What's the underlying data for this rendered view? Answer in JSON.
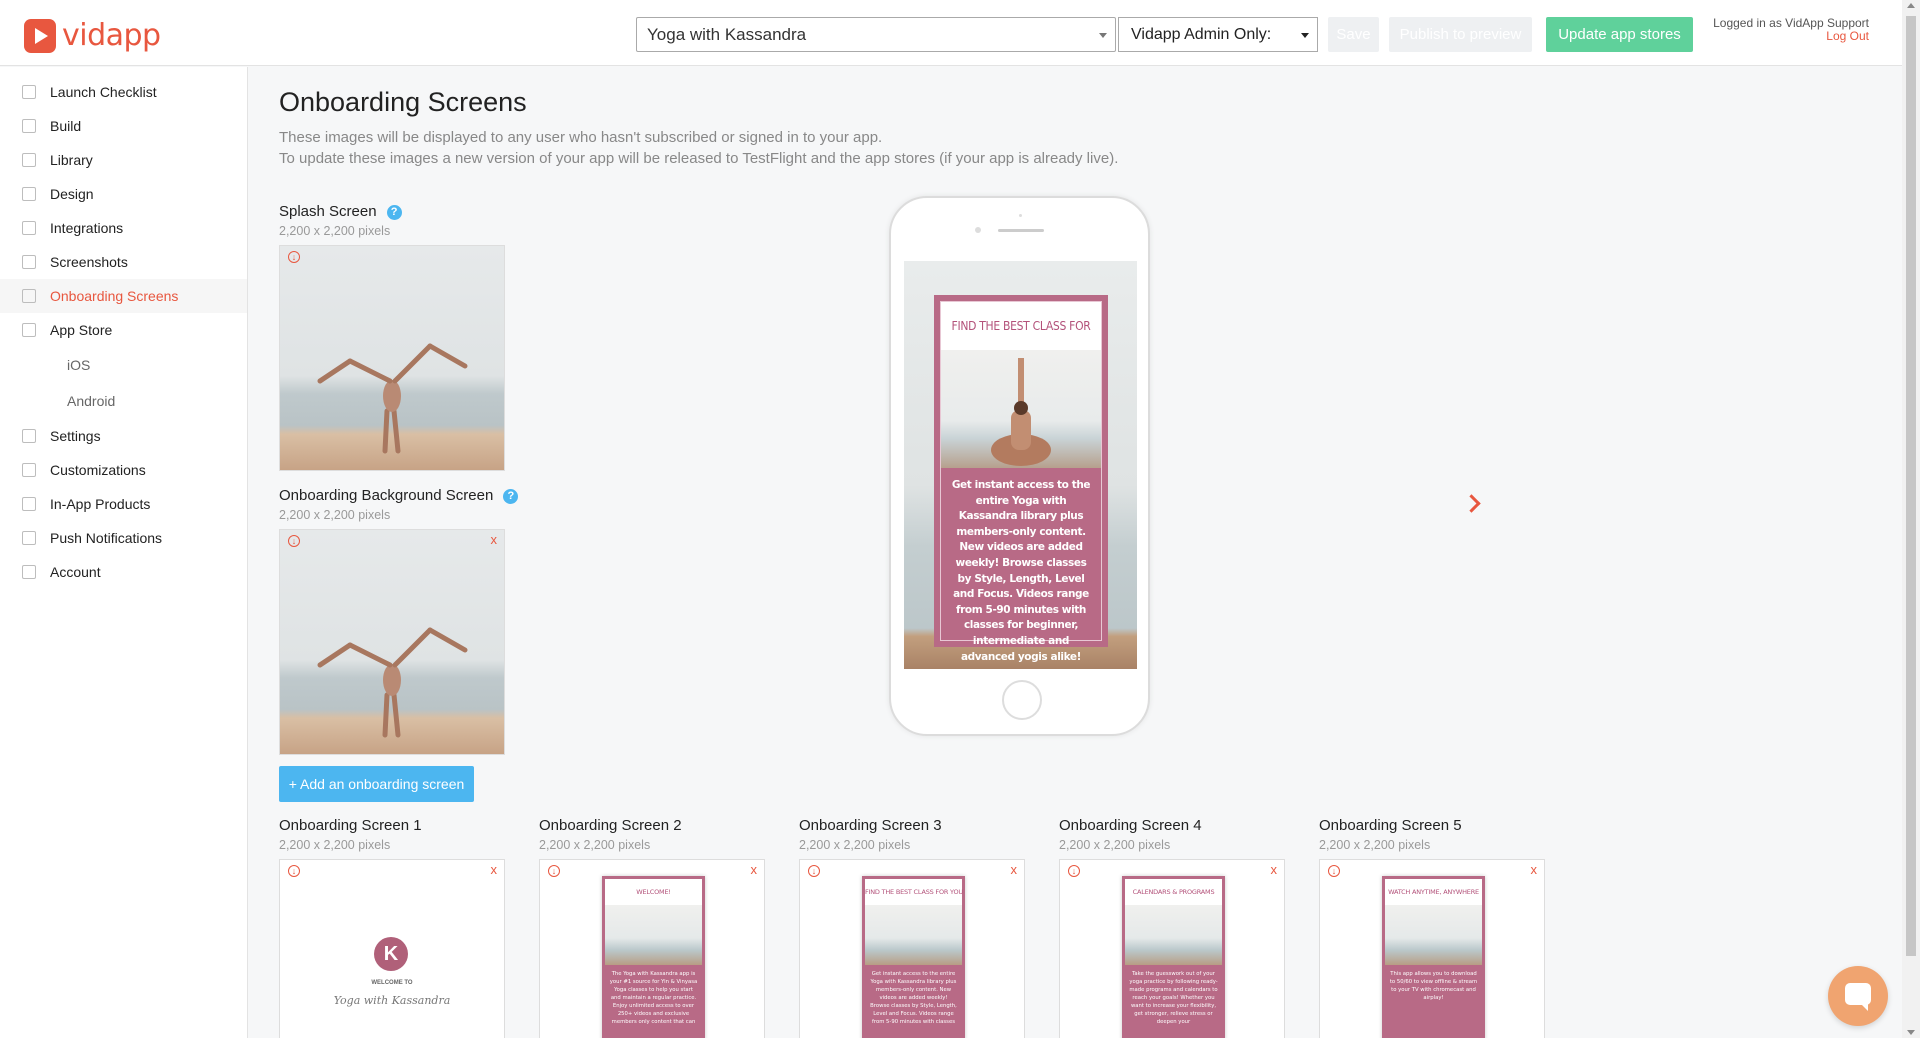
{
  "header": {
    "brand": "vidapp",
    "app_select": "Yoga with Kassandra",
    "admin_select": "Vidapp Admin Only:",
    "save_label": "Save",
    "publish_label": "Publish to preview",
    "update_label": "Update app stores",
    "logged_in": "Logged in as VidApp Support",
    "logout": "Log Out"
  },
  "sidebar": {
    "items": [
      {
        "label": "Launch Checklist",
        "icon": "checklist-icon"
      },
      {
        "label": "Build",
        "icon": "wrench-icon"
      },
      {
        "label": "Library",
        "icon": "library-icon"
      },
      {
        "label": "Design",
        "icon": "design-icon"
      },
      {
        "label": "Integrations",
        "icon": "integrations-icon"
      },
      {
        "label": "Screenshots",
        "icon": "screenshots-icon"
      },
      {
        "label": "Onboarding Screens",
        "icon": "onboarding-icon"
      },
      {
        "label": "App Store",
        "icon": "appstore-icon"
      }
    ],
    "sub_items": [
      "iOS",
      "Android"
    ],
    "items2": [
      {
        "label": "Settings",
        "icon": "settings-icon"
      },
      {
        "label": "Customizations",
        "icon": "customizations-icon"
      },
      {
        "label": "In-App Products",
        "icon": "products-icon"
      },
      {
        "label": "Push Notifications",
        "icon": "bell-icon"
      },
      {
        "label": "Account",
        "icon": "lock-icon"
      }
    ]
  },
  "main": {
    "title": "Onboarding Screens",
    "desc1": "These images will be displayed to any user who hasn't subscribed or signed in to your app.",
    "desc2": "To update these images a new version of your app will be released to TestFlight and the app stores (if your app is already live).",
    "splash_label": "Splash Screen",
    "splash_sub": "2,200 x 2,200 pixels",
    "bg_label": "Onboarding Background Screen",
    "bg_sub": "2,200 x 2,200 pixels",
    "help": "?",
    "add_button": "+ Add an onboarding screen",
    "preview": {
      "heading": "FIND THE BEST CLASS FOR YOU",
      "body": "Get instant access to the entire Yoga with Kassandra library plus members-only content. New videos are added weekly! Browse classes by Style, Length, Level and Focus. Videos range from 5-90 minutes with classes for beginner, intermediate and advanced yogis alike!"
    },
    "screens": [
      {
        "label": "Onboarding Screen 1",
        "sub": "2,200 x 2,200 pixels",
        "welcome": "WELCOME TO",
        "name": "Yoga with Kassandra",
        "initial": "K"
      },
      {
        "label": "Onboarding Screen 2",
        "sub": "2,200 x 2,200 pixels",
        "heading": "WELCOME!",
        "body": "The Yoga with Kassandra app is your #1 source for Yin & Vinyasa Yoga classes to help you start and maintain a regular practice. Enjoy unlimited access to over 250+ videos and exclusive members only content that can"
      },
      {
        "label": "Onboarding Screen 3",
        "sub": "2,200 x 2,200 pixels",
        "heading": "FIND THE BEST CLASS FOR YOU",
        "body": "Get instant access to the entire Yoga with Kassandra library plus members-only content. New videos are added weekly! Browse classes by Style, Length, Level and Focus. Videos range from 5-90 minutes with classes"
      },
      {
        "label": "Onboarding Screen 4",
        "sub": "2,200 x 2,200 pixels",
        "heading": "CALENDARS & PROGRAMS",
        "body": "Take the guesswork out of your yoga practice by following ready-made programs and calendars to reach your goals! Whether you want to increase your flexibility, get stronger, relieve stress or deepen your"
      },
      {
        "label": "Onboarding Screen 5",
        "sub": "2,200 x 2,200 pixels",
        "heading": "WATCH ANYTIME, ANYWHERE",
        "body": "This app allows you to download to 50/60 to view offline & stream to your TV with chromecast and airplay!"
      }
    ]
  },
  "colors": {
    "accent": "#e8573f",
    "green": "#5fd19b",
    "blue": "#4cb6f0",
    "pink": "#b86a86"
  }
}
